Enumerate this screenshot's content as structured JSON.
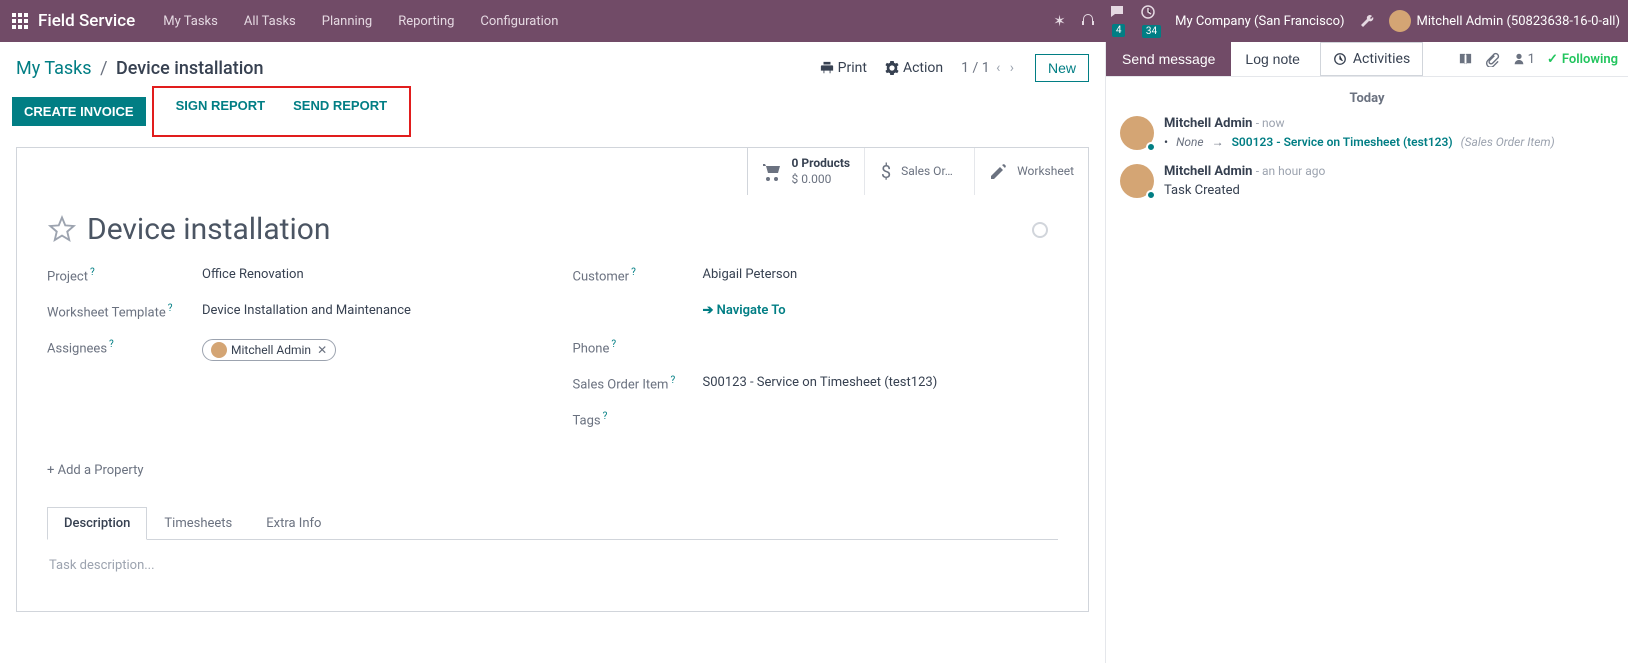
{
  "topnav": {
    "app_title": "Field Service",
    "menu": [
      "My Tasks",
      "All Tasks",
      "Planning",
      "Reporting",
      "Configuration"
    ],
    "chat_badge": "4",
    "clock_badge": "34",
    "company": "My Company (San Francisco)",
    "user": "Mitchell Admin (50823638-16-0-all)"
  },
  "breadcrumb": {
    "link": "My Tasks",
    "current": "Device installation"
  },
  "actions": {
    "print": "Print",
    "action": "Action",
    "pager": "1 / 1",
    "new": "New"
  },
  "statusbar": {
    "create_invoice": "CREATE INVOICE",
    "sign_report": "SIGN REPORT",
    "send_report": "SEND REPORT"
  },
  "stats": {
    "products_title": "0 Products",
    "products_amount": "$ 0.000",
    "sales_order": "Sales Or…",
    "worksheet": "Worksheet"
  },
  "record": {
    "title": "Device installation",
    "fields_left": {
      "project_label": "Project",
      "project_value": "Office Renovation",
      "wtemplate_label": "Worksheet Template",
      "wtemplate_value": "Device Installation and Maintenance",
      "assignees_label": "Assignees",
      "assignee_chip": "Mitchell Admin"
    },
    "fields_right": {
      "customer_label": "Customer",
      "customer_value": "Abigail Peterson",
      "navigate": "Navigate To",
      "phone_label": "Phone",
      "soi_label": "Sales Order Item",
      "soi_value": "S00123 - Service on Timesheet (test123)",
      "tags_label": "Tags"
    },
    "add_property": "Add a Property"
  },
  "tabs": {
    "items": [
      "Description",
      "Timesheets",
      "Extra Info"
    ],
    "desc_placeholder": "Task description..."
  },
  "panel": {
    "send_message": "Send message",
    "log_note": "Log note",
    "activities": "Activities",
    "follower_count": "1",
    "following": "Following",
    "today": "Today",
    "entries": [
      {
        "author": "Mitchell Admin",
        "time": "now",
        "change_old": "None",
        "change_new": "S00123 - Service on Timesheet (test123)",
        "change_label": "(Sales Order Item)"
      },
      {
        "author": "Mitchell Admin",
        "time": "an hour ago",
        "body": "Task Created"
      }
    ]
  }
}
